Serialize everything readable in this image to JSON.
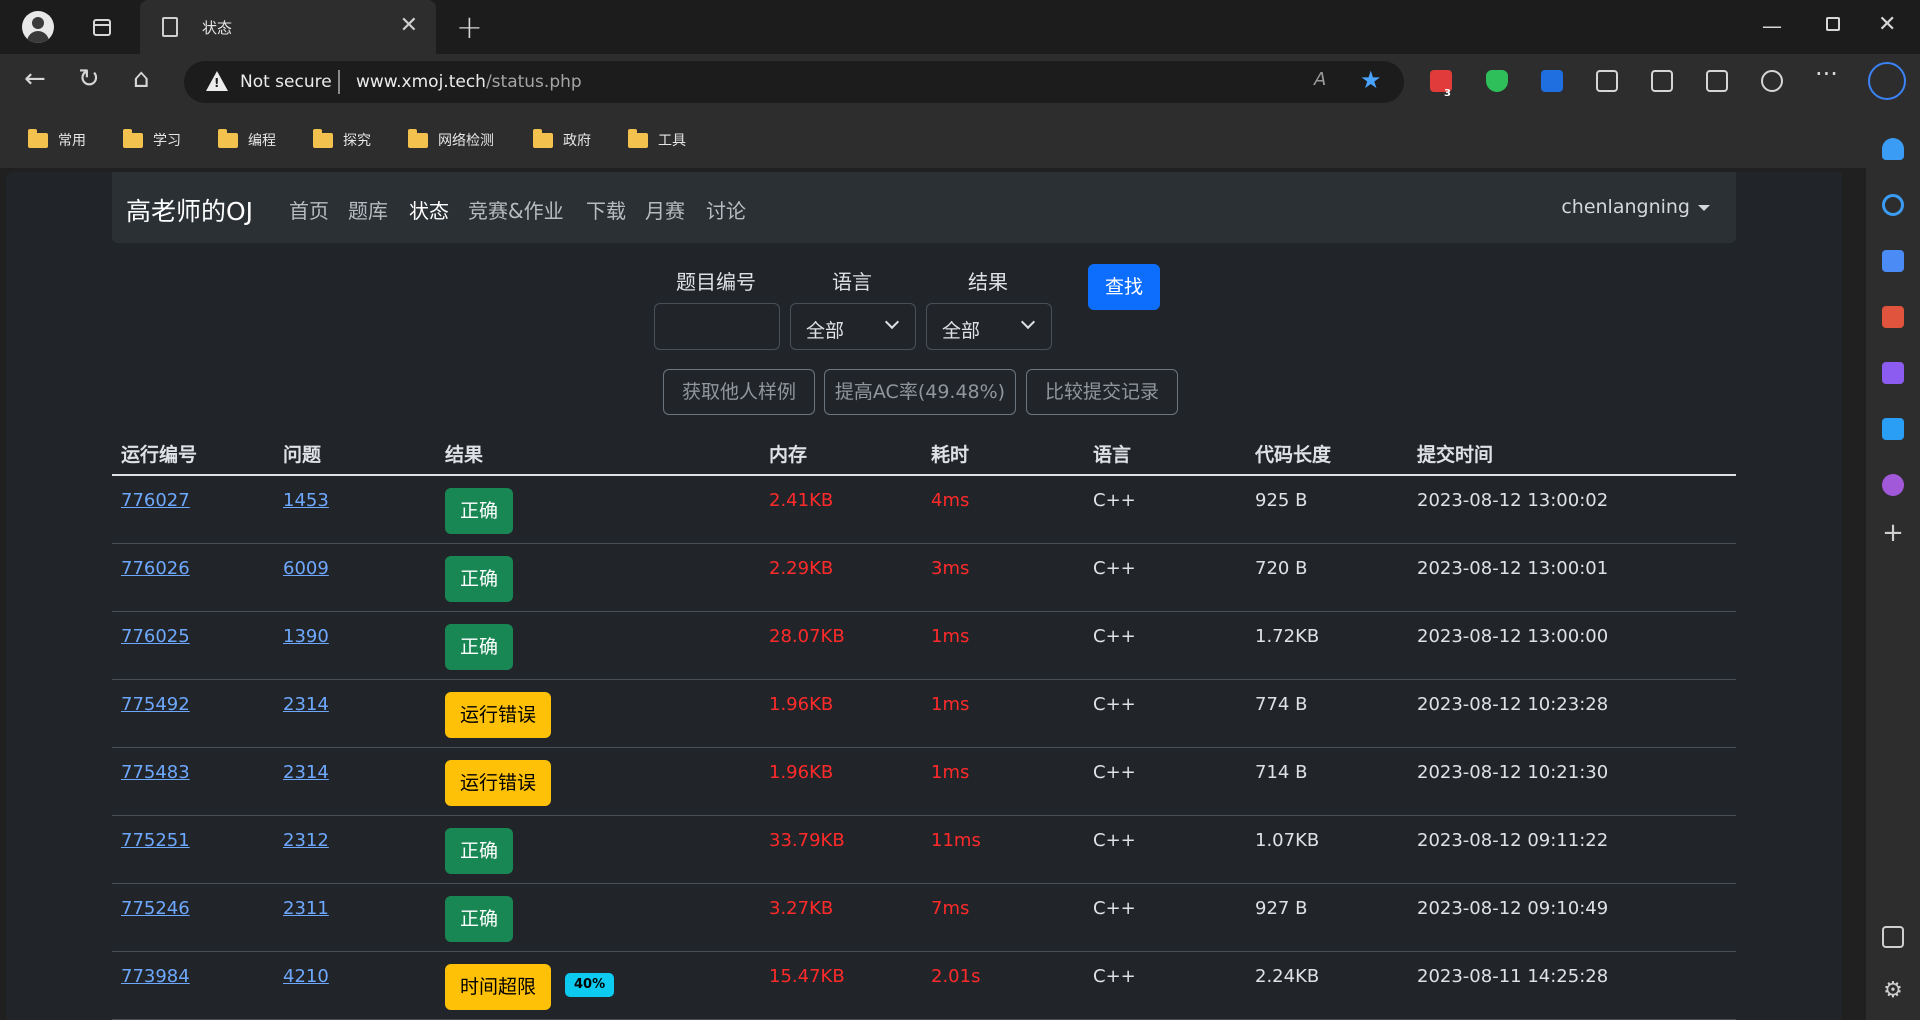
{
  "browser": {
    "tab_title": "状态",
    "url_host": "www.xmoj.tech",
    "url_path": "/status.php",
    "security_label": "Not secure",
    "extension_badge": "3",
    "bookmarks": [
      "常用",
      "学习",
      "编程",
      "探究",
      "网络检测",
      "政府",
      "工具"
    ]
  },
  "site": {
    "brand": "高老师的OJ",
    "nav": [
      "首页",
      "题库",
      "状态",
      "竞赛&作业",
      "下载",
      "月赛",
      "讨论"
    ],
    "active_nav": "状态",
    "user": "chenlangning"
  },
  "filters": {
    "problem_label": "题目编号",
    "language_label": "语言",
    "result_label": "结果",
    "problem_value": "",
    "language_value": "全部",
    "result_value": "全部",
    "search_button": "查找"
  },
  "actions": {
    "get_samples": "获取他人样例",
    "improve_ac": "提高AC率(49.48%)",
    "compare": "比较提交记录"
  },
  "table": {
    "headers": [
      "运行编号",
      "问题",
      "结果",
      "内存",
      "耗时",
      "语言",
      "代码长度",
      "提交时间"
    ],
    "rows": [
      {
        "run_id": "776027",
        "problem": "1453",
        "result": "正确",
        "status": "ok",
        "memory": "2.41KB",
        "time": "4ms",
        "lang": "C++",
        "code_len": "925 B",
        "submitted": "2023-08-12 13:00:02"
      },
      {
        "run_id": "776026",
        "problem": "6009",
        "result": "正确",
        "status": "ok",
        "memory": "2.29KB",
        "time": "3ms",
        "lang": "C++",
        "code_len": "720 B",
        "submitted": "2023-08-12 13:00:01"
      },
      {
        "run_id": "776025",
        "problem": "1390",
        "result": "正确",
        "status": "ok",
        "memory": "28.07KB",
        "time": "1ms",
        "lang": "C++",
        "code_len": "1.72KB",
        "submitted": "2023-08-12 13:00:00"
      },
      {
        "run_id": "775492",
        "problem": "2314",
        "result": "运行错误",
        "status": "warn",
        "memory": "1.96KB",
        "time": "1ms",
        "lang": "C++",
        "code_len": "774 B",
        "submitted": "2023-08-12 10:23:28"
      },
      {
        "run_id": "775483",
        "problem": "2314",
        "result": "运行错误",
        "status": "warn",
        "memory": "1.96KB",
        "time": "1ms",
        "lang": "C++",
        "code_len": "714 B",
        "submitted": "2023-08-12 10:21:30"
      },
      {
        "run_id": "775251",
        "problem": "2312",
        "result": "正确",
        "status": "ok",
        "memory": "33.79KB",
        "time": "11ms",
        "lang": "C++",
        "code_len": "1.07KB",
        "submitted": "2023-08-12 09:11:22"
      },
      {
        "run_id": "775246",
        "problem": "2311",
        "result": "正确",
        "status": "ok",
        "memory": "3.27KB",
        "time": "7ms",
        "lang": "C++",
        "code_len": "927 B",
        "submitted": "2023-08-12 09:10:49"
      },
      {
        "run_id": "773984",
        "problem": "4210",
        "result": "时间超限",
        "status": "warn",
        "pass_rate": "40%",
        "memory": "15.47KB",
        "time": "2.01s",
        "lang": "C++",
        "code_len": "2.24KB",
        "submitted": "2023-08-11 14:25:28"
      }
    ]
  },
  "colors": {
    "accepted": "#198754",
    "error": "#ffc107",
    "primary": "#0d6efd",
    "metric_red": "#ff2a2a",
    "link": "#6ea8fe"
  }
}
